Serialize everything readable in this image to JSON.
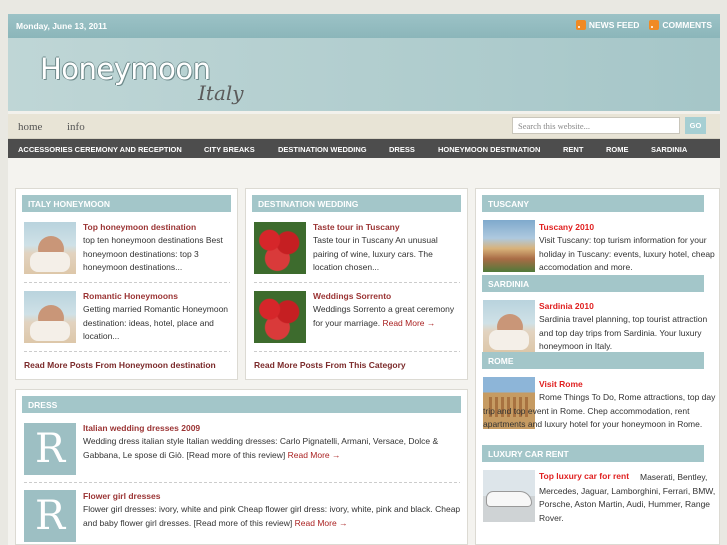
{
  "topbar": {
    "date": "Monday, June 13, 2011",
    "news_feed": "NEWS FEED",
    "comments": "COMMENTS"
  },
  "header": {
    "logo_main": "Honeymoon",
    "logo_sub": "Italy"
  },
  "nav": {
    "home": "home",
    "info": "info",
    "search_placeholder": "Search this website...",
    "go": "GO"
  },
  "categories": [
    "ACCESSORIES CEREMONY AND RECEPTION",
    "CITY BREAKS",
    "DESTINATION WEDDING",
    "DRESS",
    "HONEYMOON DESTINATION",
    "RENT",
    "ROME",
    "SARDINIA"
  ],
  "honeymoon_panel": {
    "title": "ITALY HONEYMOON",
    "items": [
      {
        "title": "Top honeymoon destination",
        "text": "top ten honeymoon destinations Best honeymoon destinations: top 3 honeymoon destinations..."
      },
      {
        "title": "Romantic Honeymoons",
        "text": "Getting married Romantic Honeymoon destination: ideas, hotel, place and location..."
      }
    ],
    "read_more": "Read More Posts From Honeymoon destination"
  },
  "wedding_panel": {
    "title": "DESTINATION WEDDING",
    "items": [
      {
        "title": "Taste tour in Tuscany",
        "text": "Taste tour in Tuscany An unusual pairing of wine, luxury cars. The location chosen..."
      },
      {
        "title": "Weddings Sorrento",
        "text": "Weddings Sorrento a great ceremony for your marriage.",
        "more": "Read More →"
      }
    ],
    "read_more": "Read More Posts From This Category"
  },
  "dress_panel": {
    "title": "DRESS",
    "items": [
      {
        "thumb": "R",
        "title": "Italian wedding dresses 2009",
        "text": "Wedding dress italian style Italian wedding dresses: Carlo Pignatelli, Armani, Versace, Dolce & Gabbana, Le spose di Giò. [Read more of this review]",
        "more": "Read More →"
      },
      {
        "thumb": "R",
        "title": "Flower girl dresses",
        "text": "Flower girl dresses: ivory, white and pink Cheap flower girl dress: ivory, white, pink and black. Cheap and baby flower girl dresses. [Read more of this review]",
        "more": "Read More →"
      }
    ]
  },
  "sidebar": {
    "sections": [
      {
        "title": "TUSCANY",
        "heading": "Tuscany 2010",
        "text": "Visit Tuscany: top turism information for your holiday in Tuscany: events, luxury hotel, cheap accomodation and more."
      },
      {
        "title": "SARDINIA",
        "heading": "Sardinia 2010",
        "text": "Sardinia travel planning, top tourist attraction and top day trips from Sardinia. Your luxury honeymoon in Italy."
      },
      {
        "title": "ROME",
        "heading": "Visit Rome",
        "text": "Rome Things To Do, Rome attractions, top day trip and top event in Rome. Chep accommodation, rent apartments and luxury hotel for your honeymoon in Rome."
      },
      {
        "title": "LUXURY CAR RENT",
        "heading": "Top luxury car for rent",
        "text": "Maserati, Bentley, Mercedes, Jaguar, Lamborghini, Ferrari, BMW, Porsche, Aston Martin, Audi, Hummer, Range Rover."
      }
    ]
  }
}
